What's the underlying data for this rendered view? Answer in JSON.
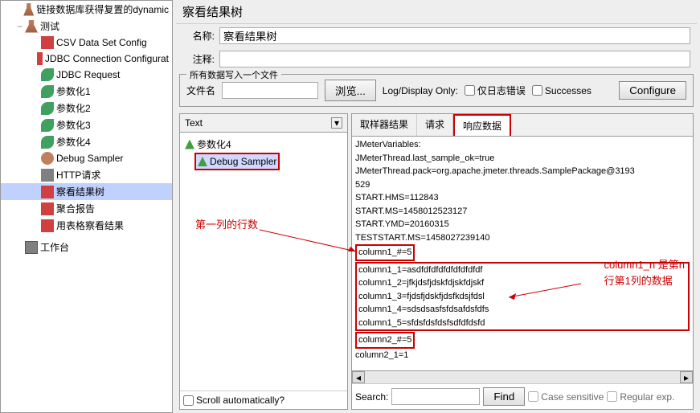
{
  "tree": {
    "items": [
      {
        "label": "链接数据库获得复置的dynamic",
        "icon": "beaker",
        "indent": 1
      },
      {
        "label": "测试",
        "icon": "beaker",
        "indent": 1,
        "toggle": "−"
      },
      {
        "label": "CSV Data Set Config",
        "icon": "csv",
        "indent": 2
      },
      {
        "label": "JDBC Connection Configurat",
        "icon": "jdbc",
        "indent": 2
      },
      {
        "label": "JDBC Request",
        "icon": "leaf",
        "indent": 2
      },
      {
        "label": "参数化1",
        "icon": "leaf",
        "indent": 2
      },
      {
        "label": "参数化2",
        "icon": "leaf",
        "indent": 2
      },
      {
        "label": "参数化3",
        "icon": "leaf",
        "indent": 2
      },
      {
        "label": "参数化4",
        "icon": "leaf",
        "indent": 2
      },
      {
        "label": "Debug Sampler",
        "icon": "bug",
        "indent": 2
      },
      {
        "label": "HTTP请求",
        "icon": "http",
        "indent": 2
      },
      {
        "label": "察看结果树",
        "icon": "tree",
        "indent": 2,
        "selected": true
      },
      {
        "label": "聚合报告",
        "icon": "agg",
        "indent": 2
      },
      {
        "label": "用表格察看结果",
        "icon": "table",
        "indent": 2
      }
    ],
    "workbench": "工作台"
  },
  "header": {
    "title": "察看结果树",
    "name_label": "名称:",
    "name_value": "察看结果树",
    "comment_label": "注释:"
  },
  "file_section": {
    "legend": "所有数据写入一个文件",
    "file_label": "文件名",
    "browse": "浏览...",
    "log_label": "Log/Display Only:",
    "errors_only": "仅日志错误",
    "successes": "Successes",
    "configure": "Configure"
  },
  "samples": {
    "text_label": "Text",
    "items": [
      {
        "label": "参数化4"
      },
      {
        "label": "Debug Sampler",
        "boxed": true
      }
    ],
    "scroll_auto": "Scroll automatically?"
  },
  "tabs": {
    "sampler": "取样器结果",
    "request": "请求",
    "response": "响应数据"
  },
  "response": {
    "lines": [
      "JMeterVariables:",
      "JMeterThread.last_sample_ok=true",
      "JMeterThread.pack=org.apache.jmeter.threads.SamplePackage@3193",
      "529",
      "START.HMS=112843",
      "START.MS=1458012523127",
      "START.YMD=20160315",
      "TESTSTART.MS=1458027239140"
    ],
    "boxed1": "column1_#=5",
    "block": [
      "column1_1=asdfdfdfdfdfdfdfdfdf",
      "column1_2=jfkjdsfjdskfdjskfdjskf",
      "column1_3=fjdsfjdskfjdsfkdsjfdsl",
      "column1_4=sdsdsasfsfdsafdsfdfs",
      "column1_5=sfdsfdsfdsfsdfdfdsfd"
    ],
    "boxed2": "column2_#=5",
    "after": "column2_1=1"
  },
  "search": {
    "label": "Search:",
    "find": "Find",
    "case": "Case sensitive",
    "regex": "Regular exp."
  },
  "annotations": {
    "anno1": "第一列的行数",
    "anno2_l1": "column1_n 是第n",
    "anno2_l2": "行第1列的数据"
  }
}
